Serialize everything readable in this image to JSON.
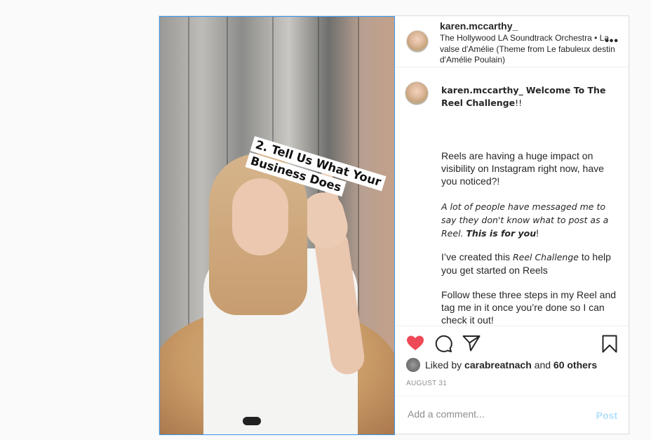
{
  "post": {
    "username": "karen.mccarthy_",
    "audio": "The Hollywood LA Soundtrack Orchestra • La valse d'Amélie (Theme from Le fabuleux destin d'Amélie Poulain)",
    "more_label": "•••",
    "sticker_lines": [
      "2. Tell Us What Your",
      "Business Does"
    ],
    "caption": {
      "username": "karen.mccarthy_",
      "title_bold": "Welcome To The Reel Challenge",
      "title_tail": "!!",
      "p1": "Reels are having a huge impact on visibility on Instagram right now, have you noticed?!",
      "p2_italic": "A lot of people have messaged me to say they don't know what to post as a Reel.",
      "p2_bold": "This is for you",
      "p2_tail": "!",
      "p3_a": "I’ve created this ",
      "p3_italic": "Reel Challenge",
      "p3_b": " to help you get started on Reels",
      "p4": "Follow these three steps in my Reel and tag me in it once you’re done so I can check it out!"
    },
    "likes": {
      "prefix": "Liked by",
      "liker": "carabreatnach",
      "joiner": "and",
      "others": "60 others"
    },
    "date": "AUGUST 31",
    "comment": {
      "placeholder": "Add a comment...",
      "post_label": "Post"
    },
    "icons": [
      "heart-icon",
      "comment-icon",
      "share-icon",
      "bookmark-icon",
      "more-icon"
    ],
    "colors": {
      "like": "#ed4956",
      "post_button_disabled": "#b2dffc",
      "selection_border": "#3897f0"
    }
  }
}
